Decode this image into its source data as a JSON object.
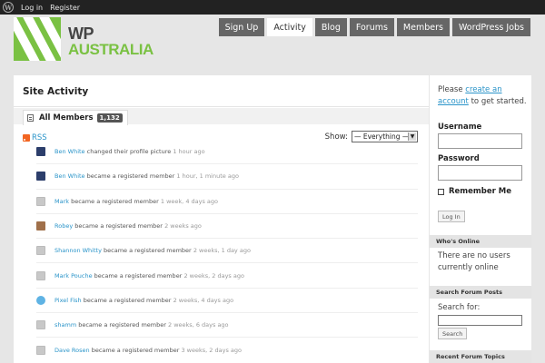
{
  "adminbar": {
    "links": [
      "Log in",
      "Register"
    ]
  },
  "logo": {
    "line1": "WP",
    "line2": "AUSTRALIA"
  },
  "nav": [
    "Sign Up",
    "Activity",
    "Blog",
    "Forums",
    "Members",
    "WordPress Jobs"
  ],
  "nav_active": "Activity",
  "content": {
    "title": "Site Activity",
    "tab_label": "All Members",
    "tab_count": "1,132",
    "rss": "RSS",
    "show_label": "Show:",
    "filter_value": "— Everything —"
  },
  "activities": [
    {
      "name": "Ben White",
      "action": "changed their profile picture",
      "time": "1 hour ago",
      "avatar": "navy"
    },
    {
      "name": "Ben White",
      "action": "became a registered member",
      "time": "1 hour, 1 minute ago",
      "avatar": "navy"
    },
    {
      "name": "Mark",
      "action": "became a registered member",
      "time": "1 week, 4 days ago",
      "avatar": "grey"
    },
    {
      "name": "Robey",
      "action": "became a registered member",
      "time": "2 weeks ago",
      "avatar": "brown"
    },
    {
      "name": "Shannon Whitty",
      "action": "became a registered member",
      "time": "2 weeks, 1 day ago",
      "avatar": "grey"
    },
    {
      "name": "Mark Pouche",
      "action": "became a registered member",
      "time": "2 weeks, 2 days ago",
      "avatar": "grey"
    },
    {
      "name": "Pixel Fish",
      "action": "became a registered member",
      "time": "2 weeks, 4 days ago",
      "avatar": "twitter"
    },
    {
      "name": "shamm",
      "action": "became a registered member",
      "time": "2 weeks, 6 days ago",
      "avatar": "grey"
    },
    {
      "name": "Dave Rosen",
      "action": "became a registered member",
      "time": "3 weeks, 2 days ago",
      "avatar": "grey"
    }
  ],
  "sidebar": {
    "intro_pre": "Please",
    "intro_link": "create an account",
    "intro_post": "to get started.",
    "username_label": "Username",
    "password_label": "Password",
    "remember_label": "Remember Me",
    "login_button": "Log In",
    "whos_online_title": "Who's Online",
    "whos_online_text": "There are no users currently online",
    "search_posts_title": "Search Forum Posts",
    "search_for_label": "Search for:",
    "search_button": "Search",
    "recent_topics_title": "Recent Forum Topics"
  },
  "colors": {
    "accent": "#7ac143",
    "link": "#2a94c9",
    "nav": "#666666",
    "adminbar": "#222222"
  }
}
